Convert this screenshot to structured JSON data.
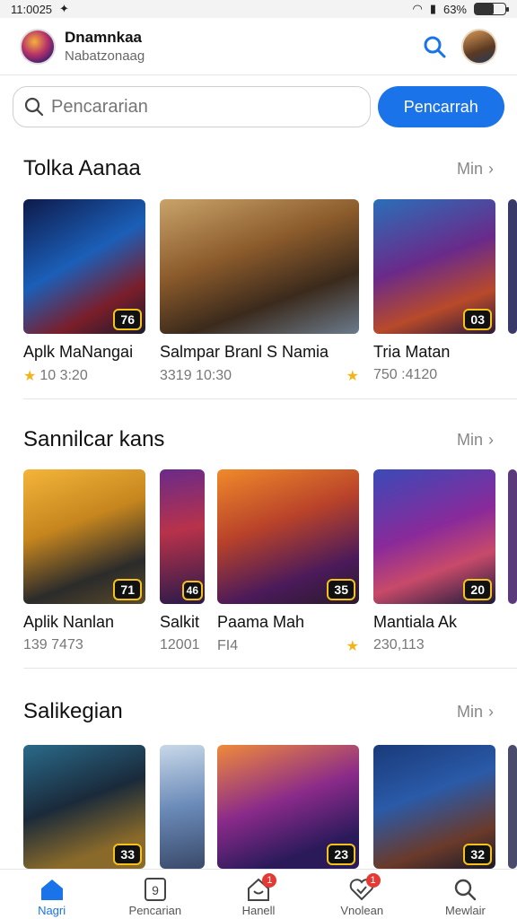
{
  "status_bar": {
    "time": "11:0025",
    "battery": "63%",
    "battery_level": 0.63
  },
  "header": {
    "title": "Dnamnkaa",
    "subtitle": "Nabatzonaag"
  },
  "search": {
    "placeholder": "Pencararian",
    "button_label": "Pencarrah"
  },
  "sections": [
    {
      "title": "Tolka Aanaa",
      "more_label": "Min",
      "cards": [
        {
          "title": "Aplk MaNangai",
          "meta": "10 3:20",
          "badge": "76"
        },
        {
          "title": "Salmpar Branl S Namia",
          "meta": "3319 10:30",
          "badge": ""
        },
        {
          "title": "Tria Matan",
          "meta": "750 :4120",
          "badge": "03"
        }
      ]
    },
    {
      "title": "Sannilcar kans",
      "more_label": "Min",
      "cards": [
        {
          "title": "Aplik Nanlan",
          "meta": "139 7473",
          "badge": "71"
        },
        {
          "title": "Salkit",
          "meta": "12001",
          "badge": "46"
        },
        {
          "title": "Paama Mah",
          "meta": "FI4",
          "badge": "35"
        },
        {
          "title": "Mantiala Ak",
          "meta": "230,113",
          "badge": "20"
        }
      ]
    },
    {
      "title": "Salikegian",
      "more_label": "Min",
      "cards": [
        {
          "title": "",
          "meta": "",
          "badge": "33"
        },
        {
          "title": "",
          "meta": "",
          "badge": ""
        },
        {
          "title": "",
          "meta": "",
          "badge": "23"
        },
        {
          "title": "",
          "meta": "",
          "badge": "32"
        }
      ]
    }
  ],
  "bottom_nav": [
    {
      "label": "Nagri",
      "icon": "home-icon",
      "active": true,
      "badge": ""
    },
    {
      "label": "Pencarian",
      "icon": "apps-icon",
      "active": false,
      "badge": ""
    },
    {
      "label": "Hanell",
      "icon": "notification-icon",
      "active": false,
      "badge": "1"
    },
    {
      "label": "Vnolean",
      "icon": "heart-icon",
      "active": false,
      "badge": "1"
    },
    {
      "label": "Mewlair",
      "icon": "search-icon",
      "active": false,
      "badge": ""
    }
  ],
  "colors": {
    "accent": "#1a73e8",
    "badge_border": "#f6c21a",
    "notification": "#e53935"
  }
}
